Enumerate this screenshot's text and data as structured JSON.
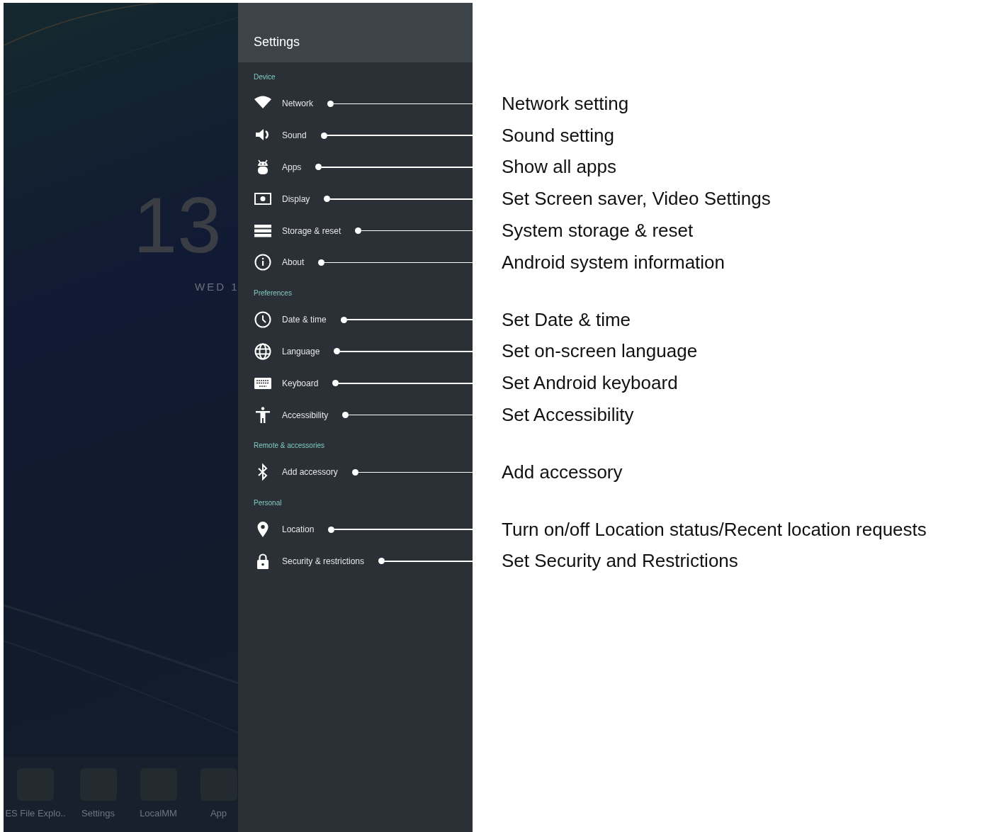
{
  "home": {
    "clock": "13",
    "date": "WED 1",
    "dock": [
      {
        "label": "ES File Explo.."
      },
      {
        "label": "Settings"
      },
      {
        "label": "LocalMM"
      },
      {
        "label": "App"
      }
    ]
  },
  "settings": {
    "title": "Settings",
    "sections": [
      {
        "header": "Device",
        "items": [
          {
            "label": "Network",
            "callout": "Network setting"
          },
          {
            "label": "Sound",
            "callout": "Sound setting"
          },
          {
            "label": "Apps",
            "callout": "Show all apps"
          },
          {
            "label": "Display",
            "callout": "Set Screen saver, Video Settings"
          },
          {
            "label": "Storage & reset",
            "callout": "System storage & reset"
          },
          {
            "label": "About",
            "callout": "Android system information"
          }
        ]
      },
      {
        "header": "Preferences",
        "items": [
          {
            "label": "Date & time",
            "callout": "Set Date & time"
          },
          {
            "label": "Language",
            "callout": "Set on-screen language"
          },
          {
            "label": "Keyboard",
            "callout": "Set Android keyboard"
          },
          {
            "label": "Accessibility",
            "callout": "Set Accessibility"
          }
        ]
      },
      {
        "header": "Remote & accessories",
        "items": [
          {
            "label": "Add accessory",
            "callout": "Add accessory"
          }
        ]
      },
      {
        "header": "Personal",
        "items": [
          {
            "label": "Location",
            "callout": "Turn on/off Location status/Recent location requests"
          },
          {
            "label": "Security & restrictions",
            "callout": "Set Security and Restrictions"
          }
        ]
      }
    ]
  }
}
